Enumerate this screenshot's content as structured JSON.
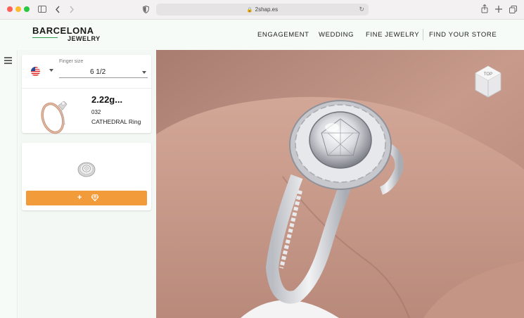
{
  "browser": {
    "url": "2shap.es",
    "icons": [
      "sidebar-toggle-icon",
      "back-icon",
      "forward-icon",
      "privacy-shield-icon",
      "lock-icon",
      "reload-icon",
      "share-icon",
      "new-tab-icon",
      "tabs-overview-icon"
    ]
  },
  "site": {
    "logo_top": "BARCELONA",
    "logo_bottom": "JEWELRY",
    "nav": [
      "ENGAGEMENT",
      "WEDDING",
      "FINE JEWELRY",
      "FIND YOUR STORE"
    ]
  },
  "configurator": {
    "finger_size_label": "Finger size",
    "finger_size_value": "6 1/2",
    "flag": "us-flag-icon",
    "weight": "2.22g...",
    "code": "032",
    "ring_name": "CATHEDRAL Ring",
    "add_button_plus": "+",
    "add_button_icon": "diamond-icon",
    "accent_color": "#f19b3a"
  },
  "viewer": {
    "cube_label": "TOP"
  }
}
